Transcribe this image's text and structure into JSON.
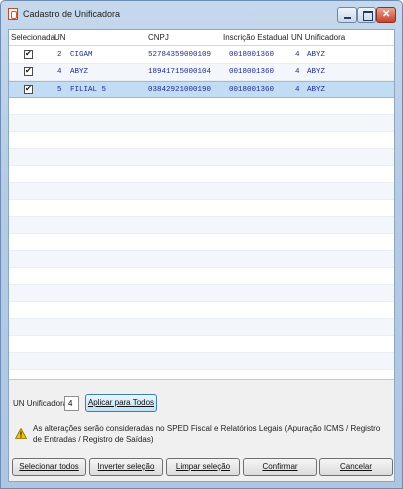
{
  "window": {
    "title": "Cadastro de Unificadora"
  },
  "grid": {
    "columns": [
      "Selecionada",
      "UN",
      "CNPJ",
      "Inscrição Estadual",
      "UN Unificadora"
    ],
    "rows": [
      {
        "selected": true,
        "un": "2",
        "un_name": "CIGAM",
        "cnpj": "52784359000109",
        "ie": "0018001360",
        "unu": "4",
        "unu_name": "ABYZ"
      },
      {
        "selected": true,
        "un": "4",
        "un_name": "ABYZ",
        "cnpj": "18941715000104",
        "ie": "0018001360",
        "unu": "4",
        "unu_name": "ABYZ"
      },
      {
        "selected": true,
        "un": "5",
        "un_name": "FILIAL 5",
        "cnpj": "03842921000190",
        "ie": "0018001360",
        "unu": "4",
        "unu_name": "ABYZ"
      }
    ],
    "highlighted_row": 2
  },
  "unificadora": {
    "label": "UN Unificadora",
    "value": "4",
    "apply_label": "Aplicar para Todos"
  },
  "warning": {
    "text": "As alterações serão consideradas no SPED Fiscal e Relatórios Legais (Apuração ICMS / Registro de Entradas / Registro de Saídas)"
  },
  "buttons": {
    "select_all": "Selecionar todos",
    "invert": "Inverter seleção",
    "clear": "Limpar seleção",
    "confirm": "Confirmar",
    "cancel": "Cancelar"
  },
  "colors": {
    "selected_row": "#c2dcf4",
    "cell_text": "#1f2a8f",
    "warning": "#f2c200"
  },
  "icons": {
    "app": "app-logo-icon",
    "warning": "warning-icon",
    "check": "check-icon"
  }
}
